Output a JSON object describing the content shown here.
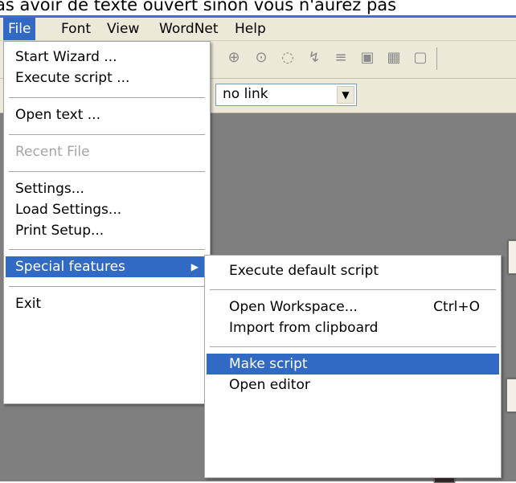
{
  "caption_text": "as avoir de texte ouvert sinon vous n'aurez pas",
  "menubar": {
    "items": [
      "File",
      "Font",
      "View",
      "WordNet",
      "Help"
    ]
  },
  "link_select": {
    "value": "no link"
  },
  "file_menu": {
    "start_wizard": "Start Wizard ...",
    "execute_script": "Execute script ...",
    "open_text": "Open text ...",
    "recent_file": "Recent File",
    "settings": "Settings...",
    "load_settings": "Load Settings...",
    "print_setup": "Print Setup...",
    "special_features": "Special features",
    "exit": "Exit"
  },
  "special_menu": {
    "execute_default_script": "Execute default script",
    "open_workspace": "Open Workspace...",
    "open_workspace_shortcut": "Ctrl+O",
    "import_clipboard": "Import from clipboard",
    "make_script": "Make script",
    "open_editor": "Open editor"
  },
  "colors": {
    "menu_highlight": "#316ac5",
    "chrome": "#ece9d8",
    "workspace": "#7f7f7f"
  }
}
